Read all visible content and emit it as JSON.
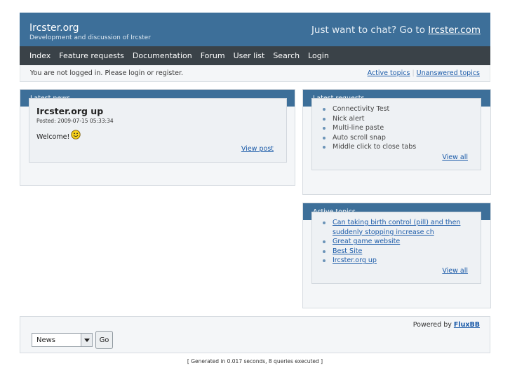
{
  "header": {
    "title": "Ircster.org",
    "description": "Development and discussion of Ircster",
    "chat_prefix": "Just want to chat? Go to ",
    "chat_link": "Ircster.com"
  },
  "nav": {
    "items": [
      "Index",
      "Feature requests",
      "Documentation",
      "Forum",
      "User list",
      "Search",
      "Login"
    ]
  },
  "status": {
    "login_message": "You are not logged in. Please login or register.",
    "active_topics": "Active topics",
    "unanswered_topics": "Unanswered topics"
  },
  "news": {
    "heading": "Latest news",
    "post_title": "Ircster.org up",
    "posted": "Posted: 2009-07-15 05:33:34",
    "body": "Welcome!",
    "view_post": "View post",
    "smiley_icon": "smiley-icon"
  },
  "requests": {
    "heading": "Latest requests",
    "items": [
      "Connectivity Test",
      "Nick alert",
      "Multi-line paste",
      "Auto scroll snap",
      "Middle click to close tabs"
    ],
    "view_all": "View all"
  },
  "active_topics": {
    "heading": "Active topics",
    "items": [
      "Can taking birth control (pill) and then suddenly stopping increase ch",
      "Great game website",
      "Best Site",
      "Ircster.org up"
    ],
    "view_all": "View all"
  },
  "footer": {
    "powered_prefix": "Powered by ",
    "powered_link": "FluxBB",
    "select_value": "News",
    "go_label": "Go",
    "generated": "[ Generated in 0.017 seconds, 8 queries executed ]"
  },
  "colors": {
    "header_bg": "#3d6f99",
    "nav_bg": "#3a4248",
    "link": "#1a5aa8"
  }
}
